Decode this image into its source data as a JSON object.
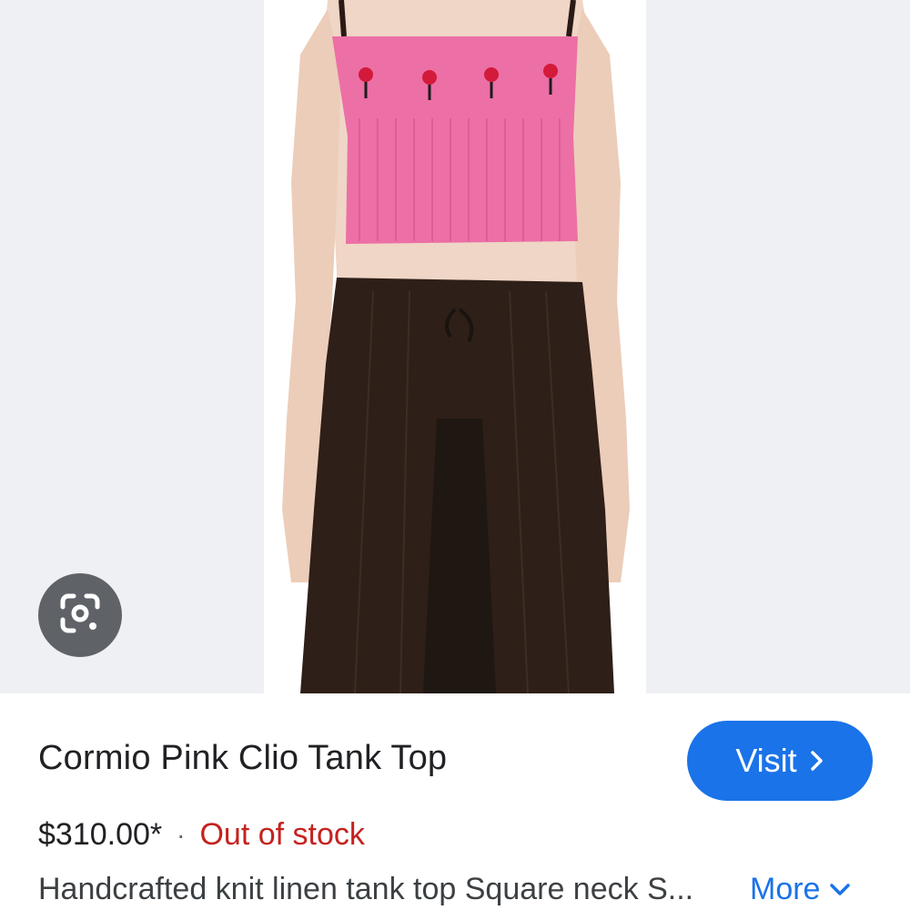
{
  "product": {
    "title": "Cormio Pink Clio Tank Top",
    "price": "$310.00*",
    "separator": "·",
    "stock_status": "Out of stock",
    "description": "Handcrafted knit linen tank top Square neck S...",
    "more_label": "More"
  },
  "actions": {
    "visit_label": "Visit"
  },
  "icons": {
    "lens": "google-lens-icon",
    "visit_chevron": "chevron-right-icon",
    "more_chevron": "chevron-down-icon"
  },
  "colors": {
    "accent": "#1a73e8",
    "out_of_stock": "#c5221f",
    "top_pink": "#ec6fa6",
    "skirt_brown": "#2e1f18"
  }
}
